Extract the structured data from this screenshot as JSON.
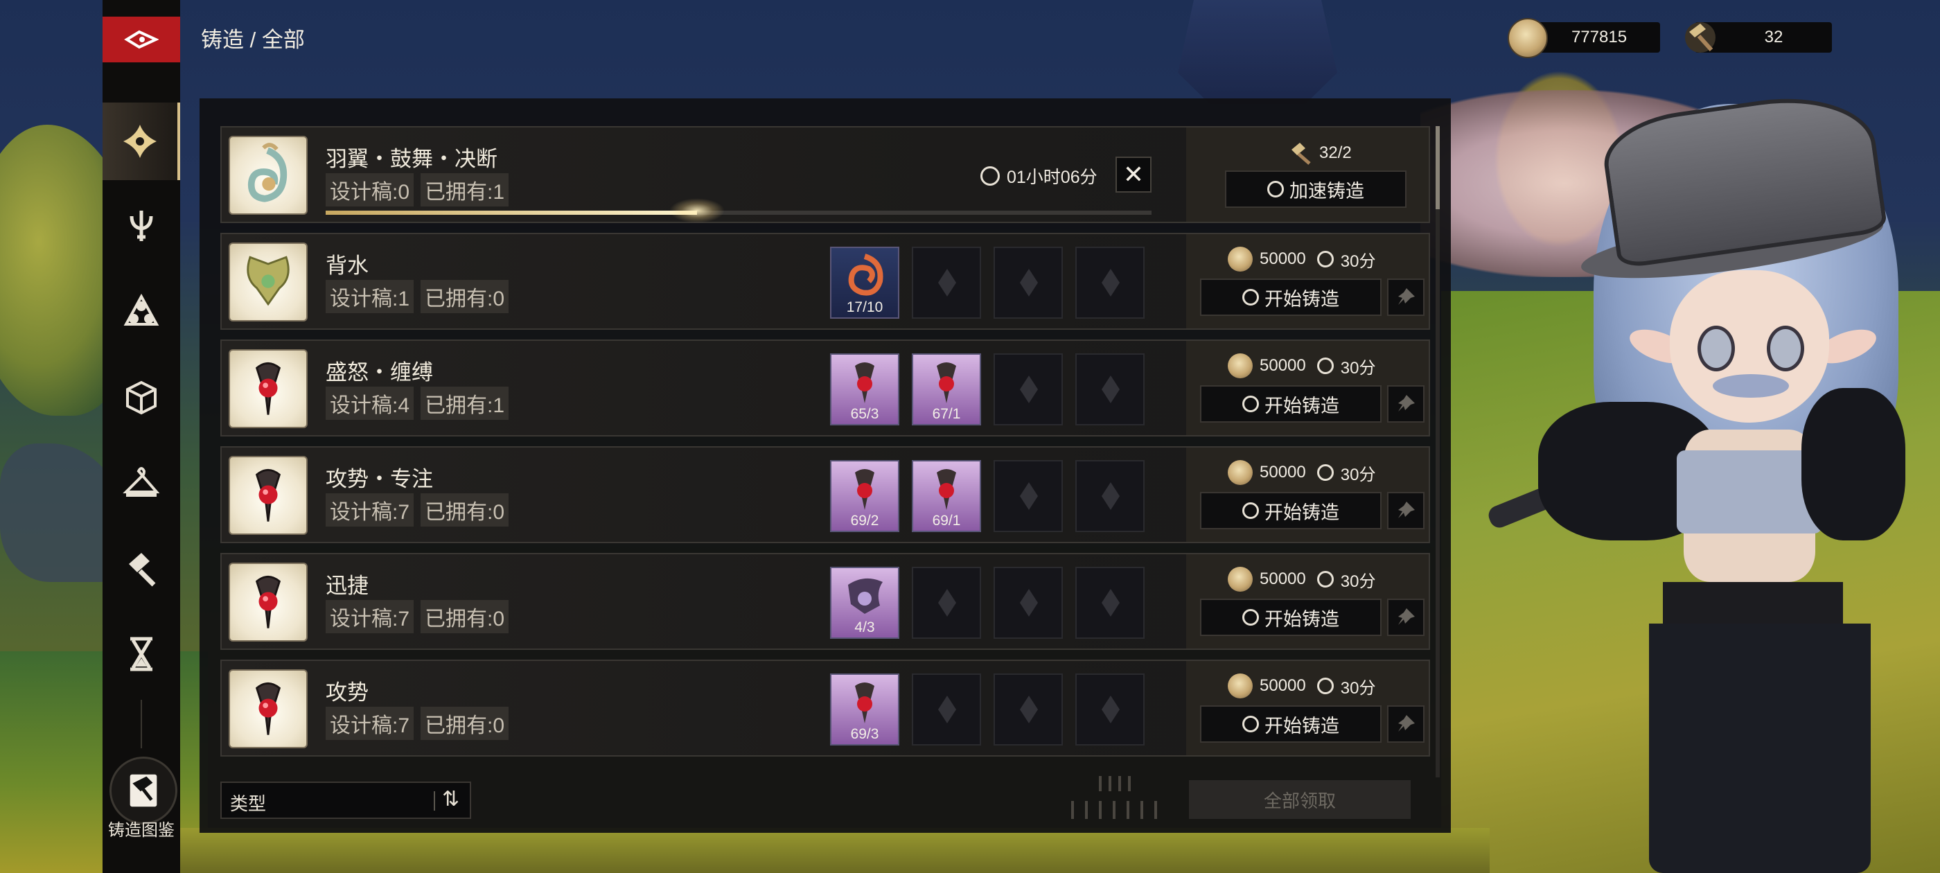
{
  "header": {
    "title": "铸造 / 全部"
  },
  "currencies": [
    {
      "icon": "gold-coin-icon",
      "value": "777815"
    },
    {
      "icon": "ore-hammer-icon",
      "value": "32"
    }
  ],
  "sidebar": {
    "items": [
      {
        "name": "sidebar-item-feather",
        "icon": "feather-star-icon",
        "active": true
      },
      {
        "name": "sidebar-item-weapon",
        "icon": "trident-icon",
        "active": false
      },
      {
        "name": "sidebar-item-triple",
        "icon": "triple-orb-icon",
        "active": false
      },
      {
        "name": "sidebar-item-cube",
        "icon": "cube-icon",
        "active": false
      },
      {
        "name": "sidebar-item-hanger",
        "icon": "hanger-icon",
        "active": false
      },
      {
        "name": "sidebar-item-hammer",
        "icon": "hammer-icon",
        "active": false
      },
      {
        "name": "sidebar-item-hourglass",
        "icon": "hourglass-icon",
        "active": false
      }
    ],
    "codex_label": "铸造图鉴"
  },
  "active_craft": {
    "name": "羽翼・鼓舞・决断",
    "design_label": "设计稿:0",
    "owned_label": "已拥有:1",
    "timer": "01小时06分",
    "progress": 0.45,
    "hammer_count": "32/2",
    "speed_button": "加速铸造"
  },
  "recipes": [
    {
      "name": "背水",
      "design_label": "设计稿:1",
      "owned_label": "已拥有:0",
      "materials": [
        {
          "count": "17/10",
          "kind": "flame"
        },
        null,
        null,
        null
      ],
      "cost": "50000",
      "time": "30分",
      "button": "开始铸造"
    },
    {
      "name": "盛怒・缠缚",
      "design_label": "设计稿:4",
      "owned_label": "已拥有:1",
      "materials": [
        {
          "count": "65/3",
          "kind": "ruby"
        },
        {
          "count": "67/1",
          "kind": "ruby"
        },
        null,
        null
      ],
      "cost": "50000",
      "time": "30分",
      "button": "开始铸造"
    },
    {
      "name": "攻势・专注",
      "design_label": "设计稿:7",
      "owned_label": "已拥有:0",
      "materials": [
        {
          "count": "69/2",
          "kind": "ruby"
        },
        {
          "count": "69/1",
          "kind": "ruby"
        },
        null,
        null
      ],
      "cost": "50000",
      "time": "30分",
      "button": "开始铸造"
    },
    {
      "name": "迅捷",
      "design_label": "设计稿:7",
      "owned_label": "已拥有:0",
      "materials": [
        {
          "count": "4/3",
          "kind": "orb"
        },
        null,
        null,
        null
      ],
      "cost": "50000",
      "time": "30分",
      "button": "开始铸造"
    },
    {
      "name": "攻势",
      "design_label": "设计稿:7",
      "owned_label": "已拥有:0",
      "materials": [
        {
          "count": "69/3",
          "kind": "ruby"
        },
        null,
        null,
        null
      ],
      "cost": "50000",
      "time": "30分",
      "button": "开始铸造"
    }
  ],
  "footer": {
    "filter_label": "类型",
    "claim_all": "全部领取"
  },
  "colors": {
    "accent_red": "#b51a1e",
    "gold": "#d8c08a",
    "panel": "#101012"
  }
}
